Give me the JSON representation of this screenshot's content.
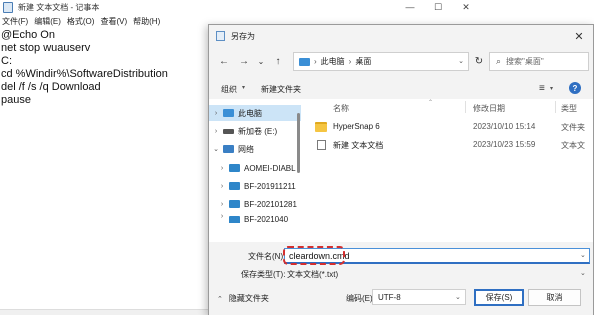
{
  "notepad": {
    "title": "新建 文本文档 - 记事本",
    "controls": {
      "minimize": "—",
      "maximize": "☐",
      "close": "✕"
    },
    "menu": [
      "文件(F)",
      "编辑(E)",
      "格式(O)",
      "查看(V)",
      "帮助(H)"
    ],
    "lines": [
      "@Echo On",
      "net stop wuauserv",
      "C:",
      "cd %Windir%\\SoftwareDistribution",
      "del /f /s /q Download",
      "pause"
    ]
  },
  "dialog": {
    "title": "另存为",
    "close": "✕",
    "nav": {
      "back": "←",
      "forward": "→",
      "recent": "⌄",
      "up": "↑",
      "refresh": "↻"
    },
    "breadcrumb": {
      "sep": "›",
      "items": [
        "此电脑",
        "桌面"
      ],
      "dropdown": "⌄"
    },
    "search_placeholder": "搜索\"桌面\"",
    "toolbar": {
      "organize": "组织",
      "caret": "▾",
      "new_folder": "新建文件夹",
      "view": "≡",
      "help": "?"
    },
    "tree": [
      {
        "label": "此电脑",
        "arrow": "›",
        "selected": true
      },
      {
        "label": "新加卷 (E:)",
        "arrow": "›",
        "selected": false
      },
      {
        "label": "网络",
        "arrow": "⌄",
        "selected": false
      },
      {
        "label": "AOMEI-DIABL",
        "arrow": "›",
        "selected": false
      },
      {
        "label": "BF-201911211",
        "arrow": "›",
        "selected": false
      },
      {
        "label": "BF-202101281",
        "arrow": "›",
        "selected": false
      },
      {
        "label": "BF-2021040",
        "arrow": "›",
        "selected": false
      }
    ],
    "columns": {
      "up": "⌃",
      "name": "名称",
      "date": "修改日期",
      "type": "类型"
    },
    "files": [
      {
        "name": "HyperSnap 6",
        "date": "2023/10/10 15:14",
        "type": "文件夹"
      },
      {
        "name": "新建 文本文档",
        "date": "2023/10/23 15:59",
        "type": "文本文"
      }
    ],
    "filename_label": "文件名(N):",
    "filename_value": "cleardown.cmd",
    "filetype_label": "保存类型(T):",
    "filetype_value": "文本文档(*.txt)",
    "dropdown": "⌄",
    "hide_caret": "⌃",
    "hide_folders": "隐藏文件夹",
    "encoding_label": "编码(E):",
    "encoding_value": "UTF-8",
    "save": "保存(S)",
    "cancel": "取消"
  },
  "colors": {
    "accent": "#2f6fc2",
    "highlight_dash": "#d32f2f",
    "selected_bg": "#cce4f7",
    "folder": "#f5c542"
  },
  "icons": [
    "notepad-icon",
    "save-dialog-icon",
    "back-arrow-icon",
    "forward-arrow-icon",
    "up-arrow-icon",
    "refresh-icon",
    "pc-icon",
    "search-icon",
    "view-list-icon",
    "help-icon",
    "drive-icon",
    "network-icon",
    "computer-icon",
    "folder-icon",
    "text-document-icon",
    "chevron-down-icon",
    "close-icon"
  ]
}
